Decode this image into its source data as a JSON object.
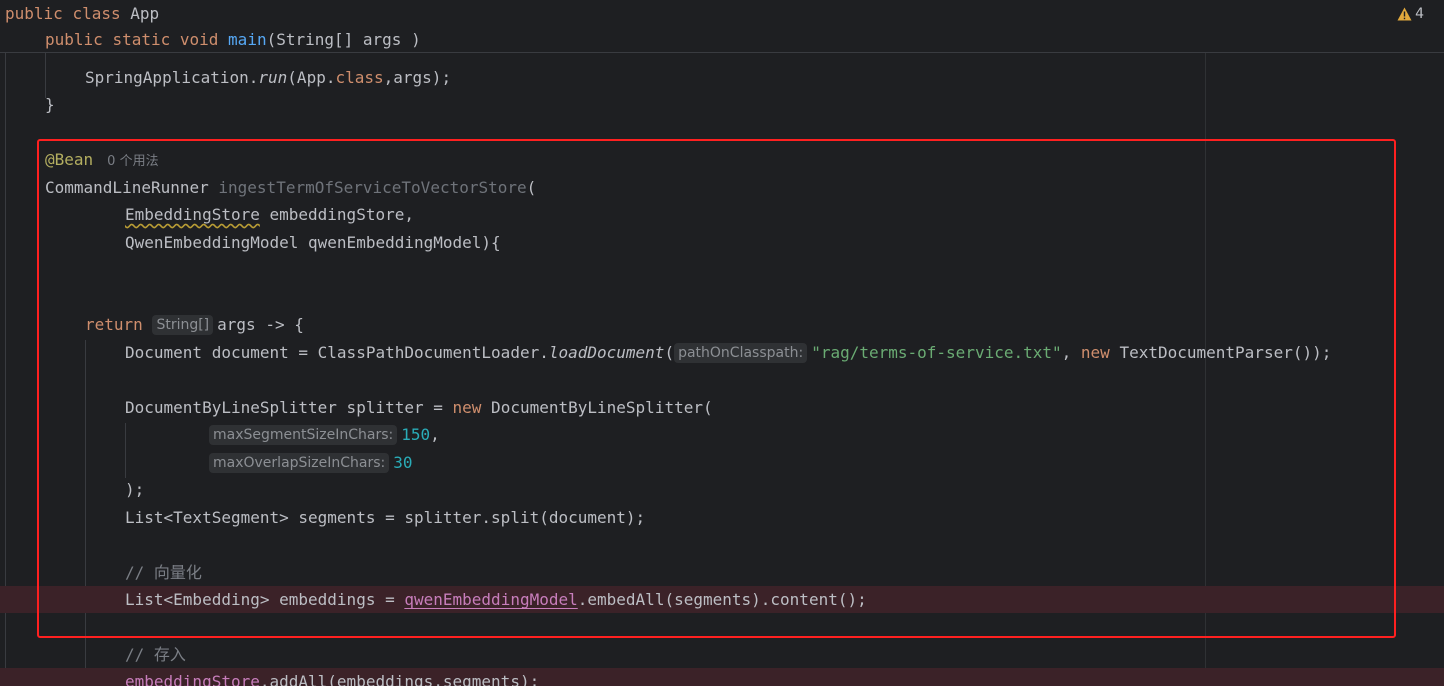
{
  "sticky": {
    "line1": {
      "kw_public": "public",
      "kw_class": "class",
      "class_name": "App"
    },
    "line2": {
      "kw_public": "public",
      "kw_static": "static",
      "kw_void": "void",
      "method": "main",
      "params": "(String[] args )"
    }
  },
  "warnings": {
    "icon": "warning-triangle-icon",
    "count": "4",
    "color": "#e2a93c"
  },
  "code": {
    "run_prefix": "SpringApplication.",
    "run_method": "run",
    "run_args_open": "(App.",
    "run_class_kw": "class",
    "run_args_close": ",args);",
    "close_brace": "}",
    "annotation": "@Bean",
    "usages": "0 个用法",
    "runner_type": "CommandLineRunner ",
    "runner_method": "ingestTermOfServiceToVectorStore",
    "runner_open": "(",
    "param1_type": "EmbeddingStore",
    "param1_name": " embeddingStore,",
    "param2": "QwenEmbeddingModel qwenEmbeddingModel){",
    "return_kw": "return",
    "return_hint": "String[]",
    "return_rest": "args -> {",
    "doc_prefix": "Document document = ClassPathDocumentLoader.",
    "doc_method": "loadDocument",
    "doc_open": "(",
    "doc_hint": "pathOnClasspath:",
    "doc_string": "\"rag/terms-of-service.txt\"",
    "doc_comma": ", ",
    "doc_new": "new",
    "doc_rest": " TextDocumentParser());",
    "splitter_prefix": "DocumentByLineSplitter splitter = ",
    "splitter_new": "new",
    "splitter_rest": " DocumentByLineSplitter(",
    "seg_hint": "maxSegmentSizeInChars:",
    "seg_value": "150",
    "seg_comma": ",",
    "overlap_hint": "maxOverlapSizeInChars:",
    "overlap_value": "30",
    "splitter_close": ");",
    "segments_line": "List<TextSegment> segments = splitter.split(document);",
    "comment_vectorize": "// 向量化",
    "embed_prefix": "List<Embedding> embeddings = ",
    "embed_field": "qwenEmbeddingModel",
    "embed_rest": ".embedAll(segments).content();",
    "comment_store": "// 存入",
    "store_field": "embeddingStore",
    "store_rest": ".addAll(embeddings,segments);"
  },
  "colors": {
    "background": "#1e1f22",
    "keyword": "#cf8e6d",
    "method": "#56a8f5",
    "annotation": "#b3ae60",
    "string": "#6aab73",
    "number": "#2aacb8",
    "field": "#c77dbb",
    "highlight_box": "#ff2020"
  }
}
